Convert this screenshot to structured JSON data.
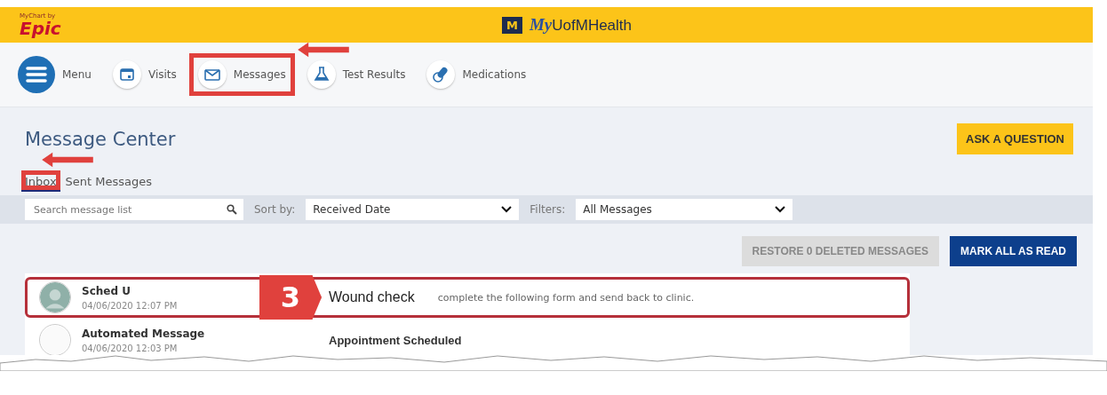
{
  "header": {
    "brand_small": "MyChart by",
    "brand": "Epic",
    "site_mark": "M",
    "site_name_prefix": "My",
    "site_name": "UofMHealth"
  },
  "nav": [
    {
      "kind": "menu",
      "label": "Menu",
      "highlighted": false,
      "arrow": false
    },
    {
      "kind": "calendar",
      "label": "Visits",
      "highlighted": false,
      "arrow": false
    },
    {
      "kind": "envelope",
      "label": "Messages",
      "highlighted": true,
      "arrow": true
    },
    {
      "kind": "flask",
      "label": "Test Results",
      "highlighted": false,
      "arrow": false
    },
    {
      "kind": "pills",
      "label": "Medications",
      "highlighted": false,
      "arrow": false
    }
  ],
  "page_title": "Message Center",
  "ask_button": "ASK A QUESTION",
  "tabs": [
    {
      "label": "Inbox",
      "selected": true,
      "highlighted": true,
      "arrow": true
    },
    {
      "label": "Sent Messages",
      "selected": false,
      "highlighted": false,
      "arrow": false
    }
  ],
  "search": {
    "placeholder": "Search message list"
  },
  "sort": {
    "label": "Sort by:",
    "value": "Received Date"
  },
  "filter": {
    "label": "Filters:",
    "value": "All Messages"
  },
  "restore_button": "RESTORE 0 DELETED MESSAGES",
  "mark_read_button": "MARK ALL AS READ",
  "messages": [
    {
      "sender": "Sched U",
      "date": "04/06/2020 12:07 PM",
      "subject": "Wound check",
      "preview": "complete the following form and send back to clinic.",
      "has_photo": true,
      "highlighted": true,
      "callout": "3"
    },
    {
      "sender": "Automated Message",
      "date": "04/06/2020 12:03 PM",
      "subject": "Appointment Scheduled",
      "has_photo": false,
      "highlighted": false
    }
  ]
}
